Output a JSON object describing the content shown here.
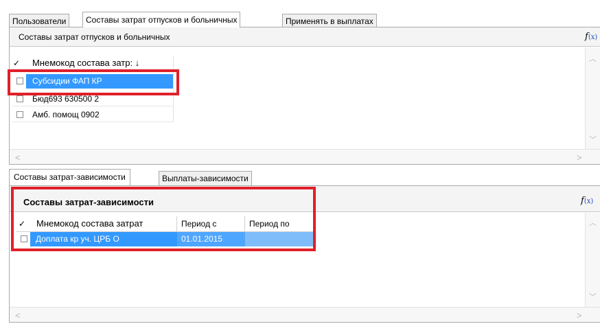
{
  "top_tabs": [
    "Пользователи",
    "Составы затрат отпусков и больничных",
    "Применять в выплатах"
  ],
  "top_grid": {
    "caption": "Составы затрат отпусков и больничных",
    "fx_label": "f",
    "fx_sub": "(x)",
    "check_col": "✓",
    "column": "Мнемокод состава затр: ↓",
    "rows": [
      "Субсидии ФАП КР",
      "Бюд693 630500 2",
      "Амб. помощ 0902"
    ]
  },
  "bottom_tabs": [
    "Составы затрат-зависимости",
    "Выплаты-зависимости"
  ],
  "bottom_grid": {
    "caption": "Составы затрат-зависимости",
    "fx_label": "f",
    "fx_sub": "(x)",
    "check_col": "✓",
    "columns": [
      "Мнемокод состава затрат",
      "Период с",
      "Период по"
    ],
    "rows": [
      {
        "code": "Доплата кр уч. ЦРБ О",
        "from": "01.01.2015",
        "to": ""
      }
    ]
  },
  "scroll_glyphs": {
    "up": "︿",
    "down": "﹀",
    "left": "<",
    "right": ">"
  },
  "colors": {
    "selection": "#3399ff",
    "highlight_border": "#e0202a"
  }
}
